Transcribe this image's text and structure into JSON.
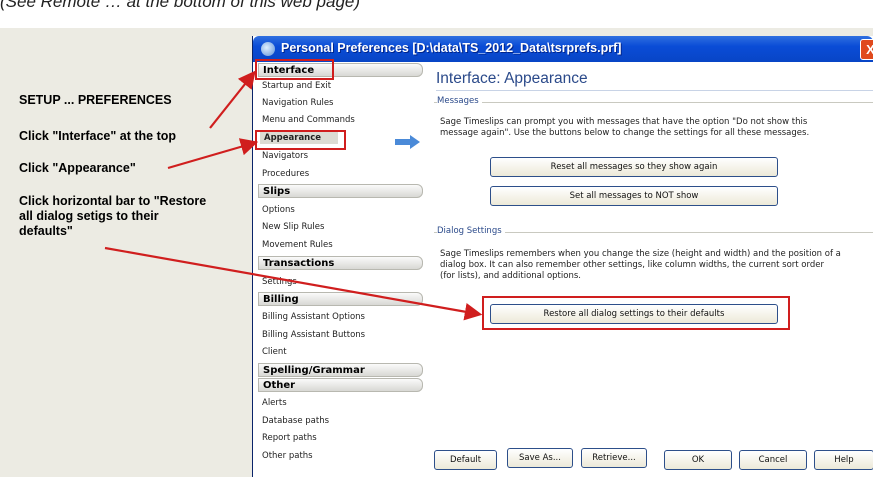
{
  "caption": "(See Remote … at the bottom of this web page)",
  "steps": {
    "setup": "SETUP ... PREFERENCES",
    "interface": "Click \"Interface\" at the top",
    "appearance": "Click \"Appearance\"",
    "restore_line1": "Click horizontal bar to \"Restore",
    "restore_line2": "all dialog setigs to their",
    "restore_line3": "defaults\""
  },
  "window": {
    "title": "Personal Preferences [D:\\data\\TS_2012_Data\\tsrprefs.prf]",
    "close_symbol": "X"
  },
  "nav": {
    "interface_header": "Interface",
    "interface_items": [
      "Startup and Exit",
      "Navigation Rules",
      "Menu and Commands",
      "Appearance",
      "Navigators",
      "Procedures"
    ],
    "slips_header": "Slips",
    "slips_items": [
      "Options",
      "New Slip Rules",
      "Movement Rules"
    ],
    "transactions_header": "Transactions",
    "transactions_items": [
      "Settings"
    ],
    "billing_header": "Billing",
    "billing_items": [
      "Billing Assistant Options",
      "Billing Assistant Buttons",
      "Client"
    ],
    "spelling_header": "Spelling/Grammar",
    "other_header": "Other",
    "other_items": [
      "Alerts",
      "Database paths",
      "Report paths",
      "Other paths"
    ],
    "selected": "Appearance"
  },
  "content": {
    "title": "Interface: Appearance",
    "messages": {
      "label": "Messages",
      "text_line1": "Sage Timeslips can prompt you with messages that have the option \"Do not show this",
      "text_line2": "message again\". Use the buttons below to change the settings for all these messages.",
      "reset_button": "Reset all messages so they show again",
      "notshow_button": "Set all messages to NOT show"
    },
    "dialog": {
      "label": "Dialog Settings",
      "text_line1": "Sage Timeslips remembers when you change the size (height and width) and the position of a",
      "text_line2": "dialog box. It can also remember other settings, like column widths, the current sort order",
      "text_line3": "(for lists), and additional options.",
      "restore_button": "Restore all dialog settings to their defaults"
    }
  },
  "footer": {
    "default": "Default",
    "save_as": "Save As...",
    "retrieve": "Retrieve...",
    "ok": "OK",
    "cancel": "Cancel",
    "help": "Help"
  },
  "colors": {
    "annotation_red": "#d01e1e",
    "slide_background": "#ecebe3",
    "titlebar_blue": "#0a4cd6",
    "heading_blue": "#2b4a8a"
  }
}
